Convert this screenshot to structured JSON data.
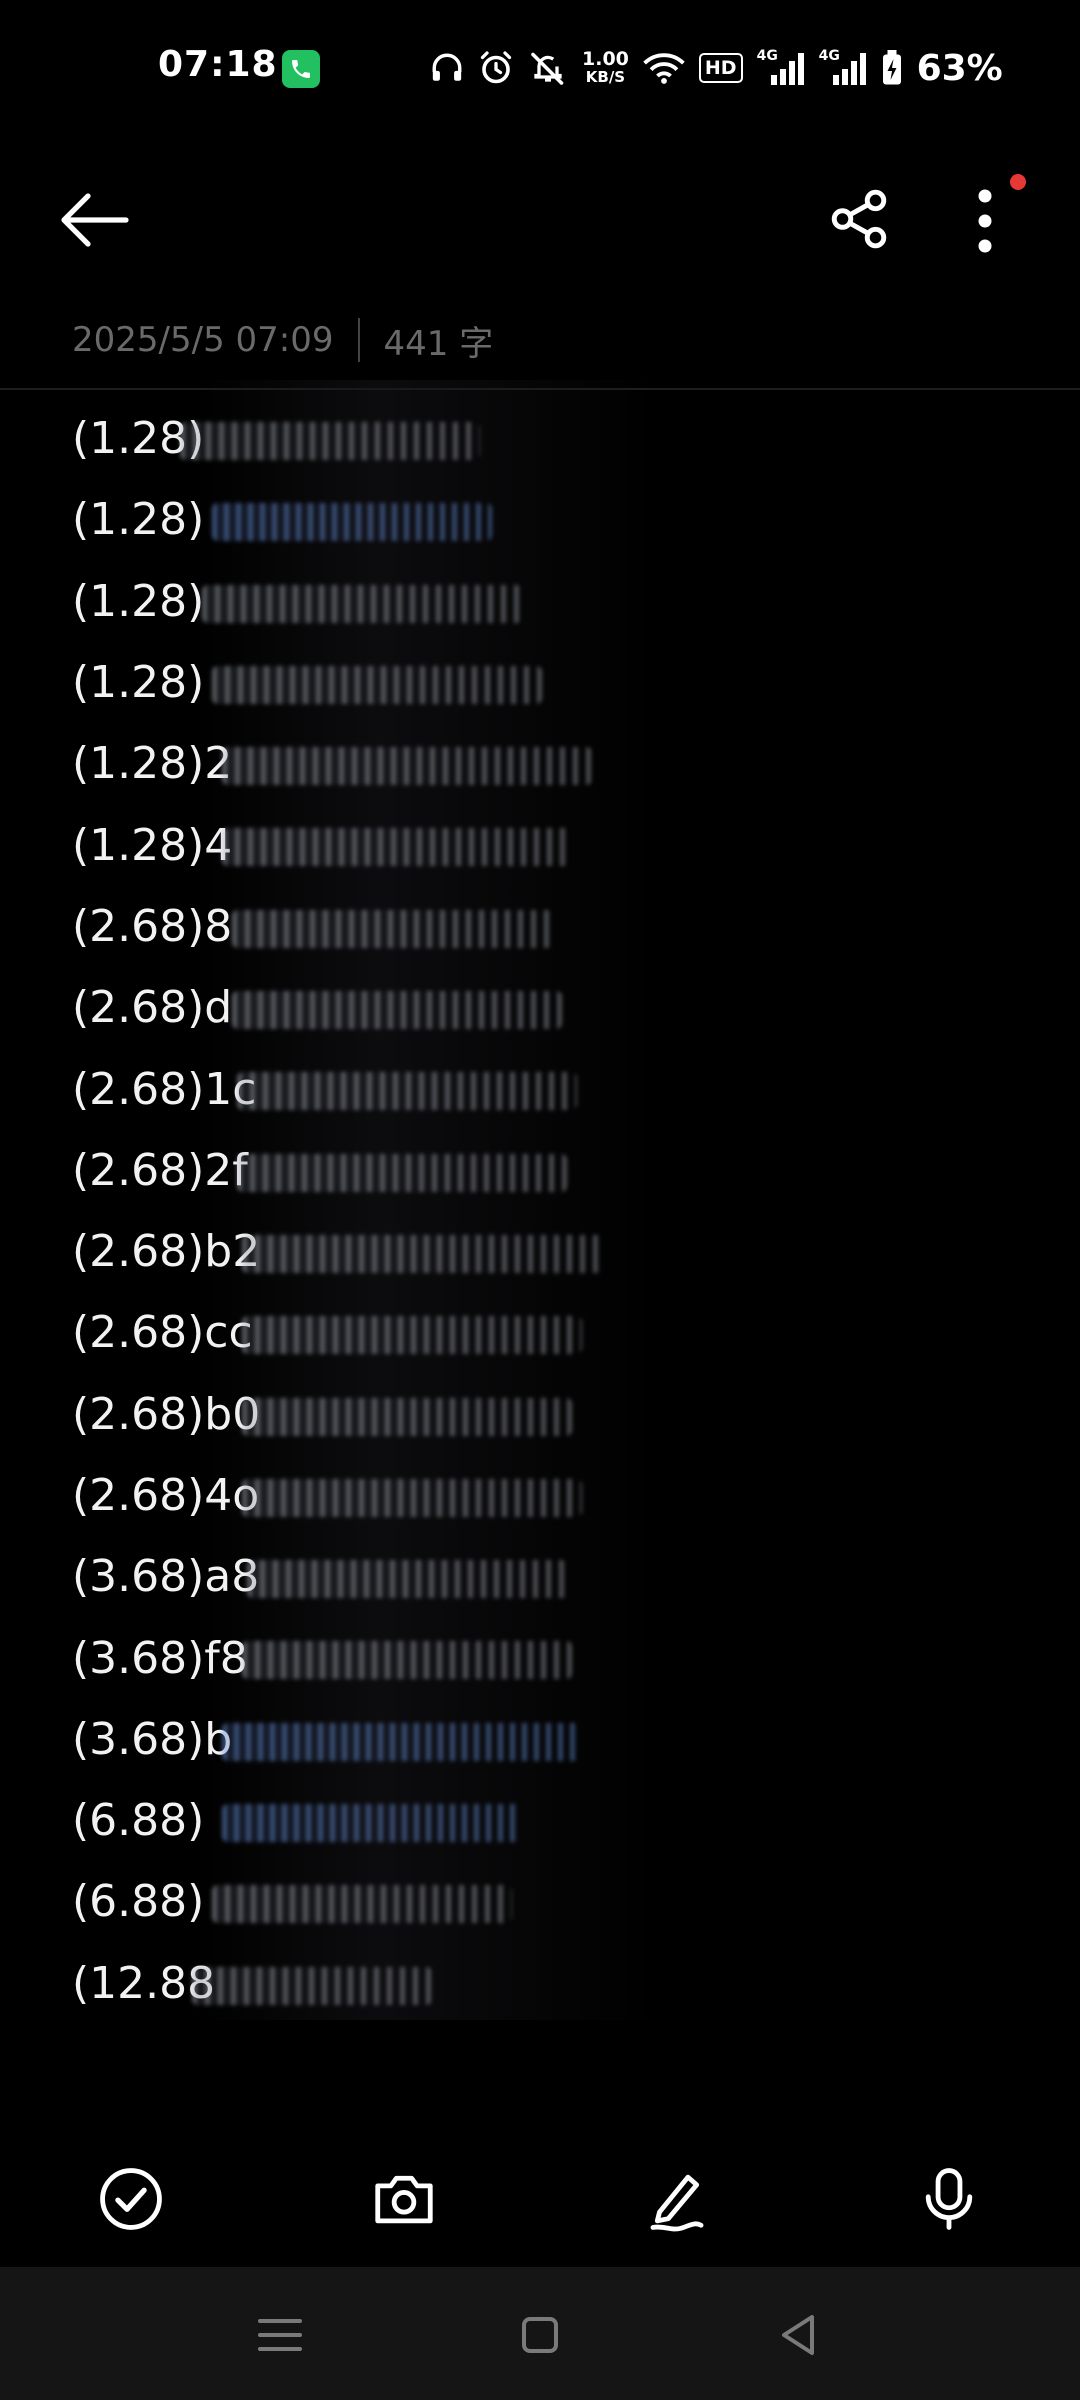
{
  "status_bar": {
    "time": "07:18",
    "net_speed_value": "1.00",
    "net_speed_unit": "KB/S",
    "hd_label": "HD",
    "signal_1_label": "4G",
    "signal_2_label": "4G",
    "battery_percent": "63%",
    "icons": [
      "phone-call-icon",
      "headphones-icon",
      "alarm-icon",
      "mute-bell-icon",
      "wifi-icon",
      "signal-icon",
      "battery-charging-icon"
    ]
  },
  "app_bar": {
    "icons": [
      "back-arrow-icon",
      "share-icon",
      "more-vertical-icon"
    ],
    "notification_dot_color": "#e53935"
  },
  "note": {
    "date": "2025/5/5 07:09",
    "char_count": "441 字",
    "lines": [
      "(1.28)",
      "(1.28)",
      "(1.28)",
      "(1.28)",
      "(1.28)2",
      "(1.28)4",
      "(2.68)8",
      "(2.68)d",
      "(2.68)1c",
      "(2.68)2f",
      "(2.68)b2",
      "(2.68)cc",
      "(2.68)b0",
      "(2.68)4o",
      "(3.68)a8",
      "(3.68)f8",
      "(3.68)b",
      "(6.88)",
      "(6.88)",
      "(12.88"
    ]
  },
  "toolbar": {
    "icons": [
      "checklist-icon",
      "camera-icon",
      "pen-icon",
      "microphone-icon"
    ]
  },
  "nav_bar": {
    "icons": [
      "menu-icon",
      "home-icon",
      "back-icon"
    ]
  },
  "colors": {
    "background": "#000000",
    "text": "#f2f2f2",
    "meta_text": "#6a6a6a",
    "nav_background": "#151515",
    "call_green": "#22c060"
  }
}
